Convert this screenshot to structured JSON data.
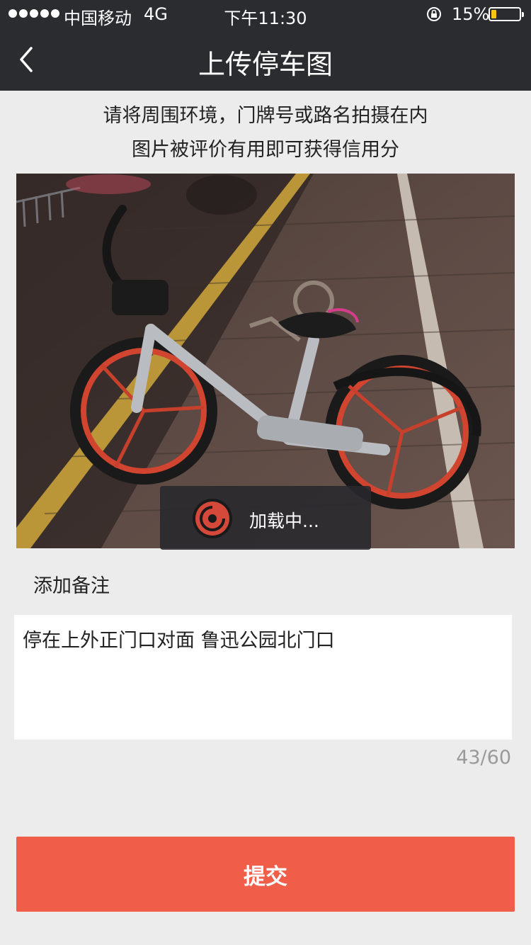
{
  "status_bar": {
    "carrier": "中国移动",
    "network": "4G",
    "time": "下午11:30",
    "battery_percent": "15%",
    "battery_level": 0.15,
    "battery_color": "#f5c518"
  },
  "nav": {
    "title": "上传停车图",
    "back_icon": "chevron-left-icon"
  },
  "instructions": {
    "line1": "请将周围环境，门牌号或路名拍摄在内",
    "line2": "图片被评价有用即可获得信用分"
  },
  "photo": {
    "loading_text": "加载中..."
  },
  "remark": {
    "label": "添加备注",
    "value": "停在上外正门口对面 鲁迅公园北门口",
    "char_count": "43/60"
  },
  "submit": {
    "label": "提交",
    "color": "#f05d48"
  }
}
